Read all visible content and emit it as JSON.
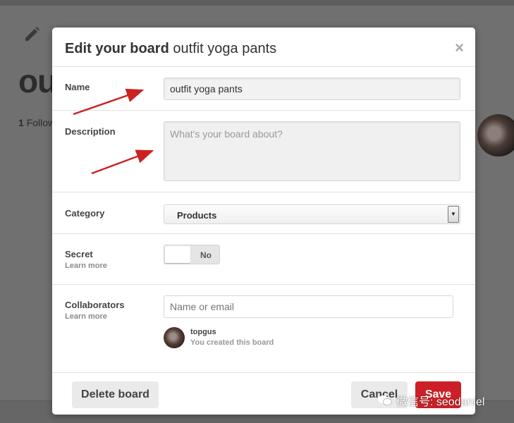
{
  "background": {
    "board_title": "ou",
    "followers_count": "1",
    "followers_label": "Follow"
  },
  "modal": {
    "title_bold": "Edit your board",
    "title_board": "outfit yoga pants",
    "close_glyph": "×"
  },
  "form": {
    "name": {
      "label": "Name",
      "value": "outfit yoga pants"
    },
    "description": {
      "label": "Description",
      "placeholder": "What's your board about?"
    },
    "category": {
      "label": "Category",
      "value": "Products"
    },
    "secret": {
      "label": "Secret",
      "learn_more": "Learn more",
      "state": "No"
    },
    "collaborators": {
      "label": "Collaborators",
      "learn_more": "Learn more",
      "placeholder": "Name or email",
      "members": [
        {
          "name": "topgus",
          "note": "You created this board"
        }
      ]
    }
  },
  "footer": {
    "delete_label": "Delete board",
    "cancel_label": "Cancel",
    "save_label": "Save"
  },
  "watermark": {
    "text": "微信号: seodaniel"
  },
  "colors": {
    "accent": "#cb2027",
    "annotation_arrow": "#cc2222"
  }
}
